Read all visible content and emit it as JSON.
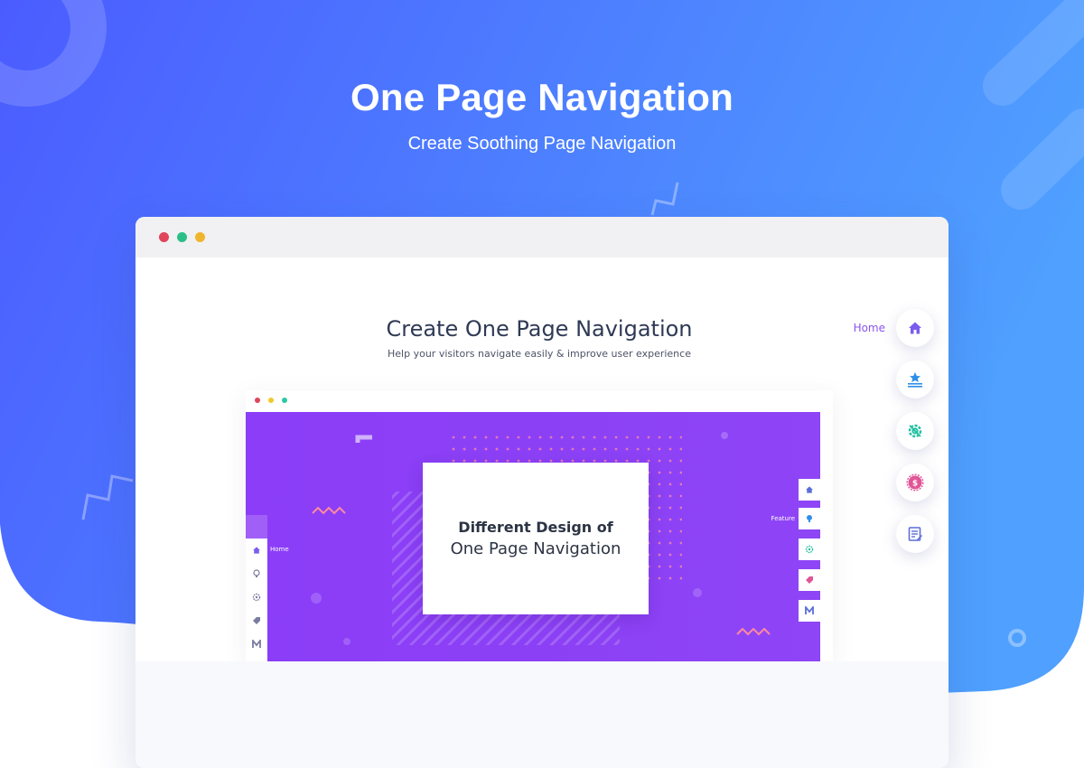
{
  "hero": {
    "title": "One Page Navigation",
    "subtitle": "Create Soothing Page Navigation"
  },
  "browser": {
    "window_dots": [
      "#e0455a",
      "#2bbf86",
      "#f0b52c"
    ]
  },
  "page": {
    "title": "Create One Page Navigation",
    "subtitle": "Help your visitors navigate easily & improve user experience"
  },
  "side_nav": {
    "tooltip": "Home",
    "items": [
      {
        "icon": "home-icon",
        "color": "#7b5cf0"
      },
      {
        "icon": "award-icon",
        "color": "#2f8fe8"
      },
      {
        "icon": "settings-gear-icon",
        "color": "#20c0a0"
      },
      {
        "icon": "dollar-badge-icon",
        "color": "#e05596"
      },
      {
        "icon": "document-edit-icon",
        "color": "#5b6fd8"
      }
    ]
  },
  "demo": {
    "window_dots": [
      "#e0455a",
      "#f0c82c",
      "#2bc9a0"
    ],
    "card_line1": "Different Design of",
    "card_line2": "One Page Navigation",
    "left_nav_label": "Home",
    "right_nav_label": "Feature",
    "left_nav_icons": [
      "home-icon",
      "lightbulb-icon",
      "gear-icon",
      "tag-icon",
      "m-logo-icon"
    ],
    "right_nav_icons": [
      "home-icon",
      "lightbulb-icon",
      "gear-icon",
      "tag-icon",
      "m-logo-icon"
    ]
  },
  "colors": {
    "hero_gradient_start": "#4d63ff",
    "hero_gradient_end": "#4f9cff",
    "demo_purple": "#8b3df7",
    "accent_purple": "#8a54ee"
  }
}
